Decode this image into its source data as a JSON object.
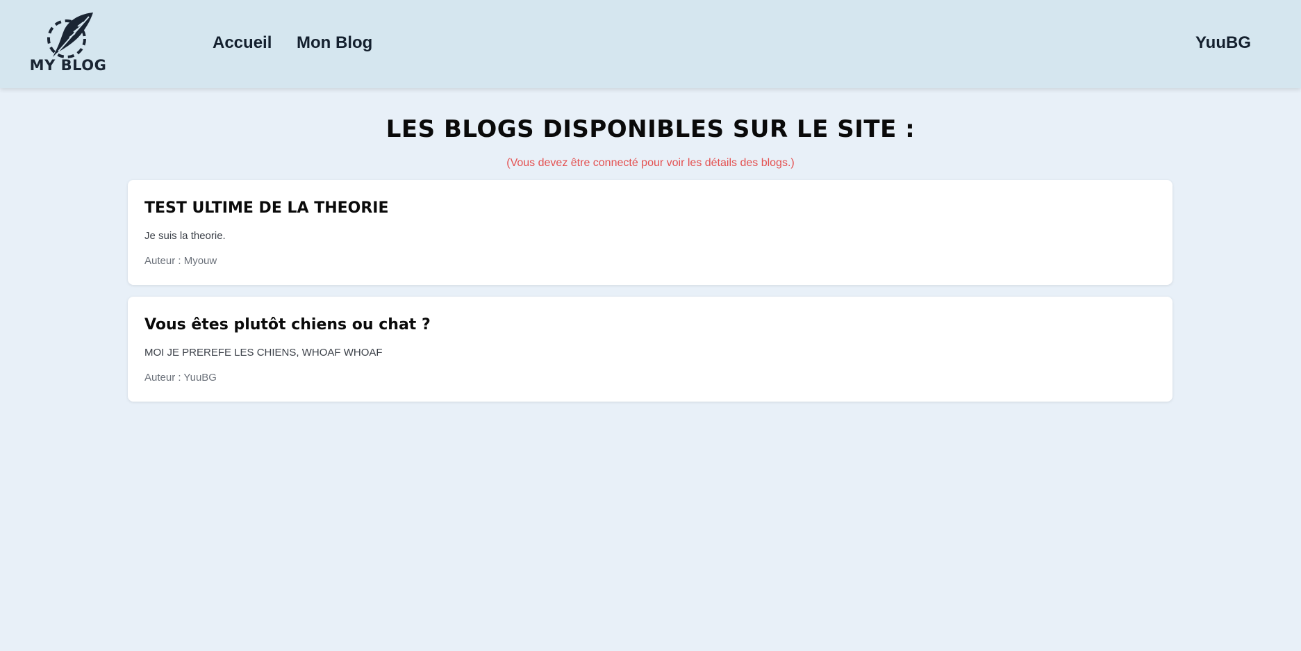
{
  "header": {
    "logo_text": "MY BLOG",
    "nav": {
      "home": "Accueil",
      "my_blog": "Mon Blog"
    },
    "user": "YuuBG"
  },
  "main": {
    "title": "LES BLOGS DISPONIBLES SUR LE SITE :",
    "notice": "(Vous devez être connecté pour voir les détails des blogs.)",
    "blogs": [
      {
        "title": "TEST ULTIME DE LA THEORIE",
        "description": "Je suis la theorie.",
        "author": "Auteur : Myouw"
      },
      {
        "title": "Vous êtes plutôt chiens ou chat ?",
        "description": "MOI JE PREREFE LES CHIENS, WHOAF WHOAF",
        "author": "Auteur : YuuBG"
      }
    ]
  },
  "colors": {
    "header_bg": "#d5e6ef",
    "page_bg": "#e8f0f8",
    "notice": "#e45050",
    "card_bg": "#ffffff"
  },
  "icons": {
    "logo": "feather-quill-icon"
  }
}
